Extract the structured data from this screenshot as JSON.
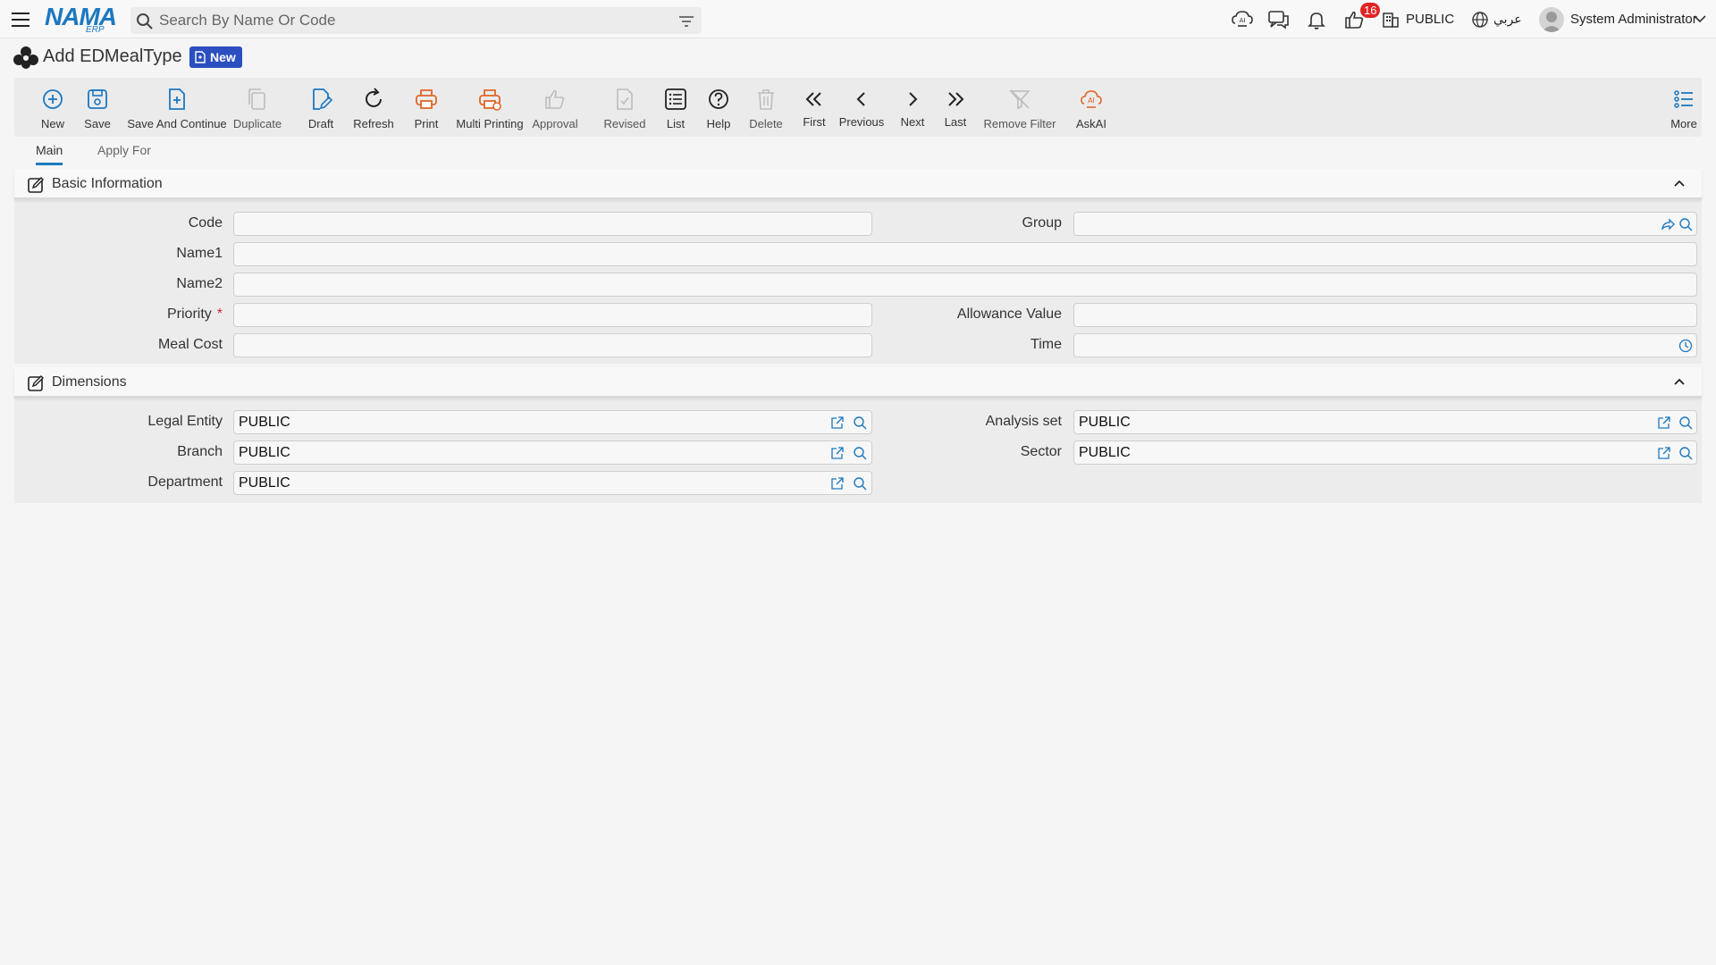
{
  "topbar": {
    "logo_main": "NAMA",
    "logo_sub": "ERP",
    "search_placeholder": "Search By Name Or Code",
    "notification_count": "16",
    "company": "PUBLIC",
    "language": "عربي",
    "user": "System Administrator"
  },
  "page": {
    "title": "Add EDMealType",
    "status_badge": "New"
  },
  "toolbar": {
    "new": "New",
    "save": "Save",
    "save_continue": "Save And Continue",
    "duplicate": "Duplicate",
    "draft": "Draft",
    "refresh": "Refresh",
    "print": "Print",
    "multi_printing": "Multi Printing",
    "approval": "Approval",
    "revised": "Revised",
    "list": "List",
    "help": "Help",
    "delete": "Delete",
    "first": "First",
    "previous": "Previous",
    "next": "Next",
    "last": "Last",
    "remove_filter": "Remove Filter",
    "askai": "AskAI",
    "more": "More"
  },
  "tabs": {
    "main": "Main",
    "apply_for": "Apply For"
  },
  "basic": {
    "title": "Basic Information",
    "code": {
      "label": "Code",
      "value": ""
    },
    "group": {
      "label": "Group",
      "value": ""
    },
    "name1": {
      "label": "Name1",
      "value": ""
    },
    "name2": {
      "label": "Name2",
      "value": ""
    },
    "priority": {
      "label": "Priority",
      "required_mark": "*",
      "value": ""
    },
    "allowance_value": {
      "label": "Allowance Value",
      "value": ""
    },
    "meal_cost": {
      "label": "Meal Cost",
      "value": ""
    },
    "time": {
      "label": "Time",
      "value": ""
    }
  },
  "dimensions": {
    "title": "Dimensions",
    "legal_entity": {
      "label": "Legal Entity",
      "value": "PUBLIC"
    },
    "analysis_set": {
      "label": "Analysis set",
      "value": "PUBLIC"
    },
    "branch": {
      "label": "Branch",
      "value": "PUBLIC"
    },
    "sector": {
      "label": "Sector",
      "value": "PUBLIC"
    },
    "department": {
      "label": "Department",
      "value": "PUBLIC"
    }
  },
  "colors": {
    "primary_blue": "#1c78c0",
    "print_orange": "#e0662a",
    "badge_red": "#e02424",
    "new_badge_blue": "#2b4fbf"
  }
}
